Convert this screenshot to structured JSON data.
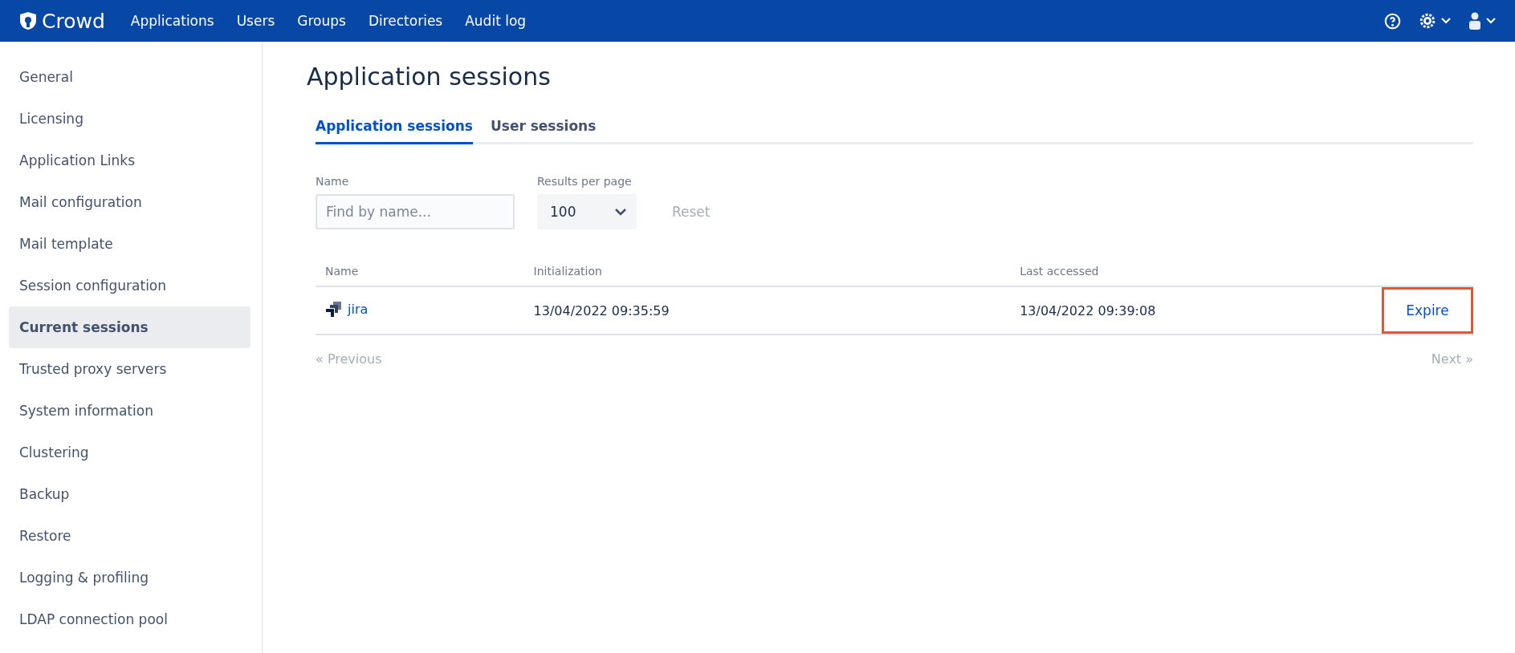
{
  "topbar": {
    "logo": "Crowd",
    "nav": [
      "Applications",
      "Users",
      "Groups",
      "Directories",
      "Audit log"
    ]
  },
  "sidebar": {
    "items": [
      {
        "label": "General",
        "selected": false
      },
      {
        "label": "Licensing",
        "selected": false
      },
      {
        "label": "Application Links",
        "selected": false
      },
      {
        "label": "Mail configuration",
        "selected": false
      },
      {
        "label": "Mail template",
        "selected": false
      },
      {
        "label": "Session configuration",
        "selected": false
      },
      {
        "label": "Current sessions",
        "selected": true
      },
      {
        "label": "Trusted proxy servers",
        "selected": false
      },
      {
        "label": "System information",
        "selected": false
      },
      {
        "label": "Clustering",
        "selected": false
      },
      {
        "label": "Backup",
        "selected": false
      },
      {
        "label": "Restore",
        "selected": false
      },
      {
        "label": "Logging & profiling",
        "selected": false
      },
      {
        "label": "LDAP connection pool",
        "selected": false
      }
    ]
  },
  "page": {
    "title": "Application sessions",
    "tabs": [
      {
        "label": "Application sessions",
        "selected": true
      },
      {
        "label": "User sessions",
        "selected": false
      }
    ],
    "filters": {
      "name_label": "Name",
      "name_placeholder": "Find by name...",
      "results_label": "Results per page",
      "results_value": "100",
      "reset": "Reset"
    },
    "table": {
      "columns": [
        "Name",
        "Initialization",
        "Last accessed"
      ],
      "rows": [
        {
          "name": "jira",
          "initialization": "13/04/2022 09:35:59",
          "last_accessed": "13/04/2022 09:39:08",
          "action": "Expire",
          "highlighted": true
        }
      ]
    },
    "pagination": {
      "previous": "« Previous",
      "next": "Next »"
    }
  }
}
